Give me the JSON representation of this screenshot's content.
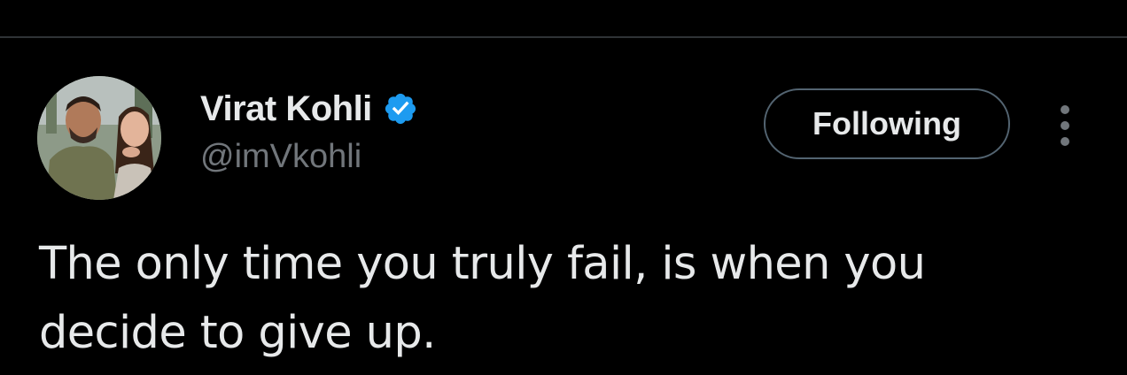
{
  "author": {
    "display_name": "Virat Kohli",
    "handle": "@imVkohli",
    "verified_icon": "verified-badge-icon",
    "avatar_icon": "profile-photo"
  },
  "actions": {
    "follow_label": "Following",
    "more_icon": "more-options-icon"
  },
  "tweet": {
    "text": "The only time you truly fail, is when you decide to give up."
  },
  "colors": {
    "background": "#000000",
    "primary_text": "#e7e9ea",
    "secondary_text": "#71767b",
    "divider": "#2f3336",
    "button_border": "#536471",
    "verified_blue": "#1d9bf0"
  }
}
